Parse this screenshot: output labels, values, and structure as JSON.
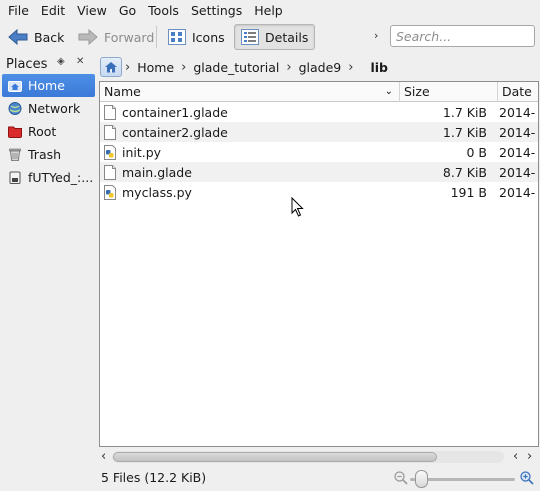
{
  "menubar": {
    "items": [
      "File",
      "Edit",
      "View",
      "Go",
      "Tools",
      "Settings",
      "Help"
    ]
  },
  "toolbar": {
    "back_label": "Back",
    "forward_label": "Forward",
    "icons_label": "Icons",
    "details_label": "Details",
    "search_placeholder": "Search..."
  },
  "places": {
    "title": "Places",
    "items": [
      {
        "label": "Home",
        "icon": "home-icon",
        "selected": true
      },
      {
        "label": "Network",
        "icon": "network-icon"
      },
      {
        "label": "Root",
        "icon": "root-folder-icon"
      },
      {
        "label": "Trash",
        "icon": "trash-icon"
      },
      {
        "label": "fUTYed_:...",
        "icon": "drive-icon"
      }
    ]
  },
  "breadcrumb": {
    "items": [
      "Home",
      "glade_tutorial",
      "glade9"
    ],
    "current": "lib"
  },
  "columns": {
    "name": "Name",
    "size": "Size",
    "date": "Date"
  },
  "files": [
    {
      "name": "container1.glade",
      "size": "1.7 KiB",
      "date": "2014-",
      "type": "glade"
    },
    {
      "name": "container2.glade",
      "size": "1.7 KiB",
      "date": "2014-",
      "type": "glade"
    },
    {
      "name": "init.py",
      "size": "0 B",
      "date": "2014-",
      "type": "python"
    },
    {
      "name": "main.glade",
      "size": "8.7 KiB",
      "date": "2014-",
      "type": "glade"
    },
    {
      "name": "myclass.py",
      "size": "191 B",
      "date": "2014-",
      "type": "python"
    }
  ],
  "status": {
    "text": "5 Files (12.2 KiB)"
  },
  "colors": {
    "selection": "#3b7ad8",
    "background": "#efefef"
  }
}
